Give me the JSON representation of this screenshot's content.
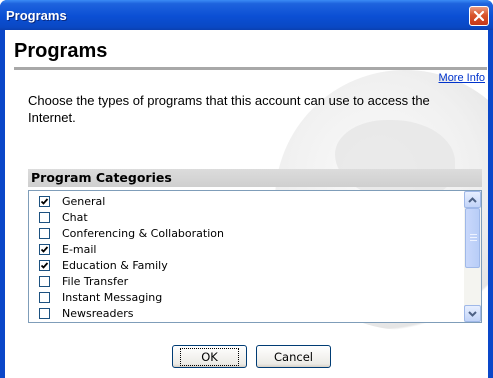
{
  "window": {
    "title": "Programs"
  },
  "page": {
    "heading": "Programs",
    "more_info_link": "More Info",
    "description": "Choose the types of programs that this account can use to access the Internet."
  },
  "categories": {
    "header": "Program Categories",
    "items": [
      {
        "label": "General",
        "checked": true
      },
      {
        "label": "Chat",
        "checked": false
      },
      {
        "label": "Conferencing & Collaboration",
        "checked": false
      },
      {
        "label": "E-mail",
        "checked": true
      },
      {
        "label": "Education & Family",
        "checked": true
      },
      {
        "label": "File Transfer",
        "checked": false
      },
      {
        "label": "Instant Messaging",
        "checked": false
      },
      {
        "label": "Newsreaders",
        "checked": false
      }
    ]
  },
  "buttons": {
    "ok": "OK",
    "cancel": "Cancel"
  },
  "colors": {
    "titlebar": "#0b4fd4",
    "link": "#0033cc",
    "close": "#d9542a"
  }
}
